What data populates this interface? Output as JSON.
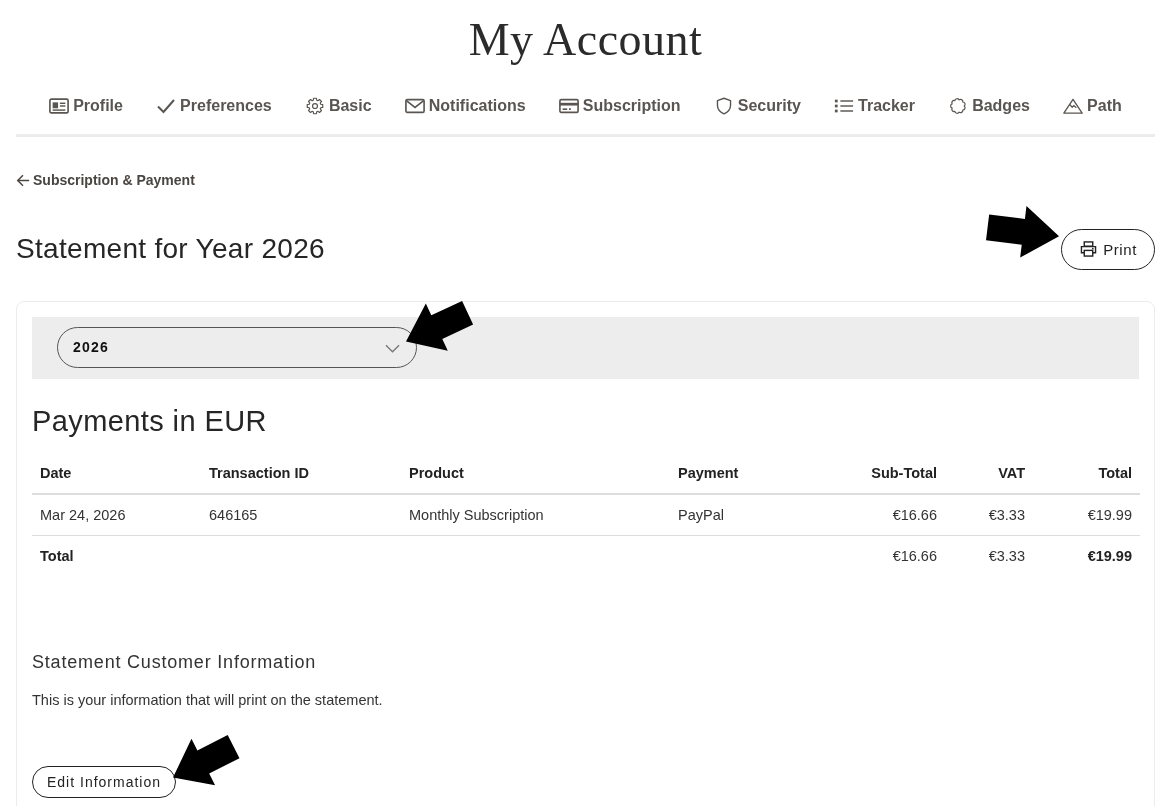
{
  "page_title": "My Account",
  "nav_tabs": [
    {
      "label": "Profile",
      "kind": "profile"
    },
    {
      "label": "Preferences",
      "kind": "preferences"
    },
    {
      "label": "Basic",
      "kind": "basic"
    },
    {
      "label": "Notifications",
      "kind": "notifications"
    },
    {
      "label": "Subscription",
      "kind": "subscription"
    },
    {
      "label": "Security",
      "kind": "security"
    },
    {
      "label": "Tracker",
      "kind": "tracker"
    },
    {
      "label": "Badges",
      "kind": "badges"
    },
    {
      "label": "Path",
      "kind": "path"
    }
  ],
  "back_link": {
    "label": "Subscription & Payment"
  },
  "heading": "Statement for Year 2026",
  "print_button": {
    "label": "Print",
    "pointer_arrow": true
  },
  "year_select": {
    "value": "2026",
    "pointer_arrow": true
  },
  "payments": {
    "title": "Payments in EUR",
    "columns": [
      {
        "label": "Date",
        "kind": "text"
      },
      {
        "label": "Transaction ID",
        "kind": "text"
      },
      {
        "label": "Product",
        "kind": "text"
      },
      {
        "label": "Payment",
        "kind": "text"
      },
      {
        "label": "Sub-Total",
        "kind": "amount"
      },
      {
        "label": "VAT",
        "kind": "amount"
      },
      {
        "label": "Total",
        "kind": "amount"
      }
    ],
    "rows": [
      [
        "Mar 24, 2026",
        "646165",
        "Monthly Subscription",
        "PayPal",
        "€16.66",
        "€3.33",
        "€19.99"
      ]
    ],
    "total_row": {
      "label": "Total",
      "subtotal": "€16.66",
      "vat": "€3.33",
      "total": "€19.99"
    }
  },
  "customer_info": {
    "title": "Statement Customer Information",
    "text": "This is your information that will print on the statement.",
    "edit_button": {
      "label": "Edit Information",
      "pointer_arrow": true
    }
  }
}
